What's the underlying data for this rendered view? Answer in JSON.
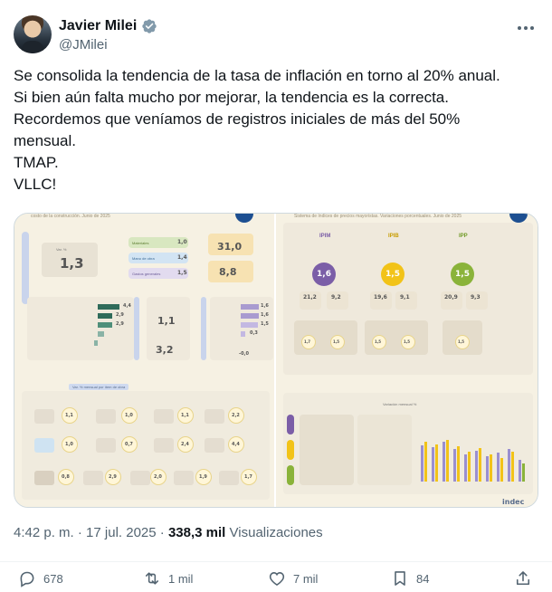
{
  "author": {
    "name": "Javier Milei",
    "handle": "@JMilei"
  },
  "tweet": {
    "lines": [
      "Se consolida la tendencia de la tasa de inflación en torno al 20% anual.",
      "Si bien aún falta mucho por mejorar, la tendencia es la correcta.",
      "Recordemos que veníamos de registros iniciales de más del 50%",
      "mensual.",
      "TMAP.",
      "VLLC!"
    ]
  },
  "media": {
    "left": {
      "title": "costo de la construcción. Junio de 2025",
      "total": "1,3",
      "breakdown": [
        {
          "label": "Materiales",
          "value": "1,0"
        },
        {
          "label": "Mano de obra",
          "value": "1,4"
        },
        {
          "label": "Gastos generales",
          "value": "1,5"
        }
      ],
      "side_values": [
        "31,0",
        "8,8"
      ],
      "mid_values": [
        "4,4",
        "2,9",
        "2,9",
        "1,1",
        "3,2"
      ],
      "right_values": [
        "1,6",
        "1,6",
        "1,5",
        "0,3",
        "-0,0"
      ],
      "section_label": "Var. % mensual por ítem de obra",
      "items": [
        "1,1",
        "1,0",
        "1,1",
        "2,2",
        "1,0",
        "0,7",
        "2,4",
        "4,4",
        "0,8",
        "2,9",
        "2,0",
        "1,9",
        "1,7"
      ]
    },
    "right": {
      "title": "Sistema de índices de precios mayoristas. Variaciones porcentuales. Junio de 2025",
      "indices": [
        {
          "name": "IPIM",
          "value": "1,6",
          "color": "#7b5ea7",
          "sub": [
            "21,2",
            "9,2"
          ],
          "items": [
            "1,7",
            "1,5"
          ]
        },
        {
          "name": "IPIB",
          "value": "1,5",
          "color": "#f2c318",
          "sub": [
            "19,6",
            "9,1"
          ],
          "items": [
            "1,5",
            "1,5"
          ]
        },
        {
          "name": "IPP",
          "value": "1,5",
          "color": "#8ab33a",
          "sub": [
            "20,9",
            "9,3"
          ],
          "items": [
            "1,5"
          ]
        }
      ],
      "legend": "Variación mensual %",
      "series_colors": [
        "#9a8fd0",
        "#f2c318",
        "#8ab33a"
      ],
      "footer": "indec"
    }
  },
  "meta": {
    "time": "4:42 p. m.",
    "date": "17 jul. 2025",
    "separator": "·",
    "views_count": "338,3 mil",
    "views_label": "Visualizaciones"
  },
  "actions": {
    "replies": "678",
    "reposts": "1 mil",
    "likes": "7 mil",
    "bookmarks": "84"
  },
  "icons": [
    "verified-badge-icon",
    "more-options-icon",
    "reply-icon",
    "repost-icon",
    "like-icon",
    "bookmark-icon",
    "share-icon"
  ],
  "colors": {
    "verified": "#829aab",
    "text": "#0f1419",
    "muted": "#536471"
  }
}
